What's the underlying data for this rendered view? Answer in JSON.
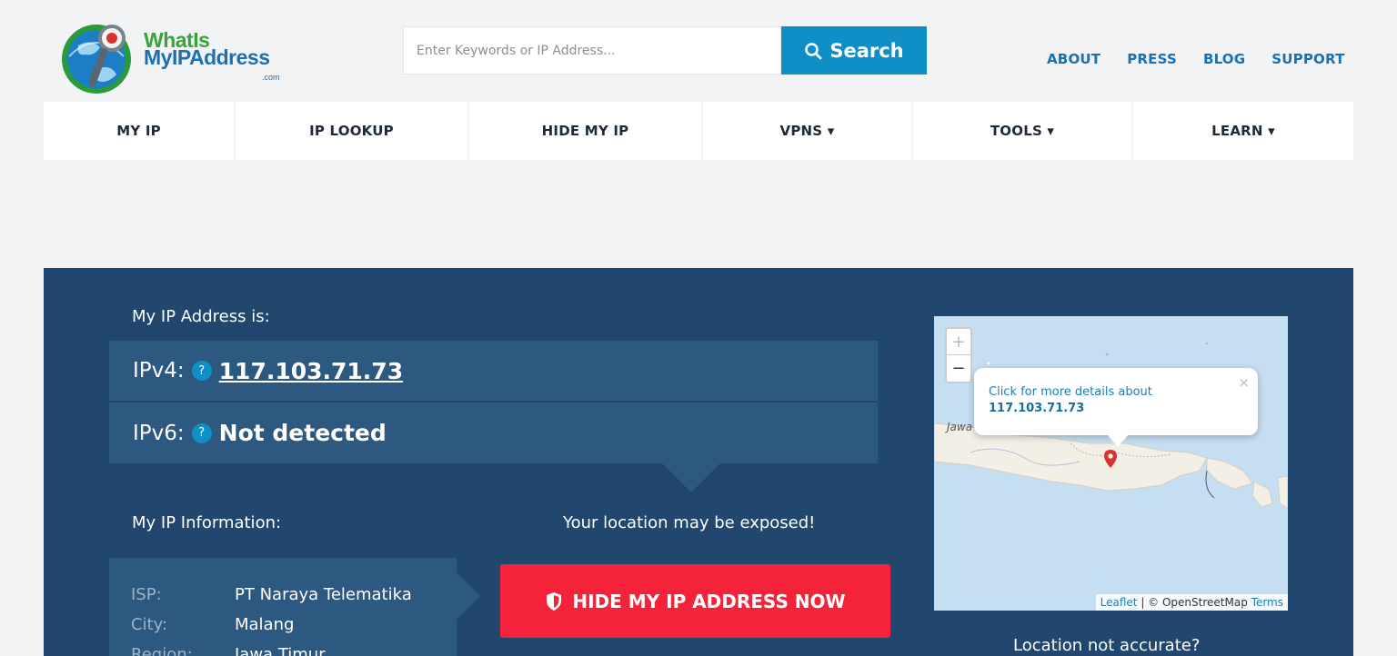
{
  "logo": {
    "line1": "WhatIs",
    "line2": "MyIPAddress",
    "suffix": ".com"
  },
  "search": {
    "placeholder": "Enter Keywords or IP Address...",
    "button_label": "Search"
  },
  "top_links": [
    "ABOUT",
    "PRESS",
    "BLOG",
    "SUPPORT"
  ],
  "main_nav": [
    "MY IP",
    "IP LOOKUP",
    "HIDE MY IP",
    "VPNS ▾",
    "TOOLS ▾",
    "LEARN ▾"
  ],
  "hero": {
    "heading": "My IP Address is:",
    "ipv4_label": "IPv4:",
    "ipv4_value": "117.103.71.73",
    "ipv6_label": "IPv6:",
    "ipv6_value": "Not detected",
    "help_glyph": "?",
    "info_heading": "My IP Information:",
    "exposed_text": "Your location may be exposed!",
    "hide_button": "HIDE MY IP ADDRESS NOW",
    "info": [
      {
        "key": "ISP:",
        "value": "PT Naraya Telematika"
      },
      {
        "key": "City:",
        "value": "Malang"
      },
      {
        "key": "Region:",
        "value": "Jawa Timur"
      }
    ],
    "location_question": "Location not accurate?"
  },
  "map": {
    "zoom_in": "+",
    "zoom_out": "−",
    "popup_text": "Click for more details about",
    "popup_ip": "117.103.71.73",
    "popup_close": "×",
    "place_label": "Jawa",
    "attr_leaflet": "Leaflet",
    "attr_sep": "| © OpenStreetMap",
    "attr_terms": "Terms"
  },
  "colors": {
    "brand_blue": "#0f8fc6",
    "hero_bg": "#21476f",
    "hero_row": "#2d5880",
    "cta_red": "#f5233a"
  }
}
